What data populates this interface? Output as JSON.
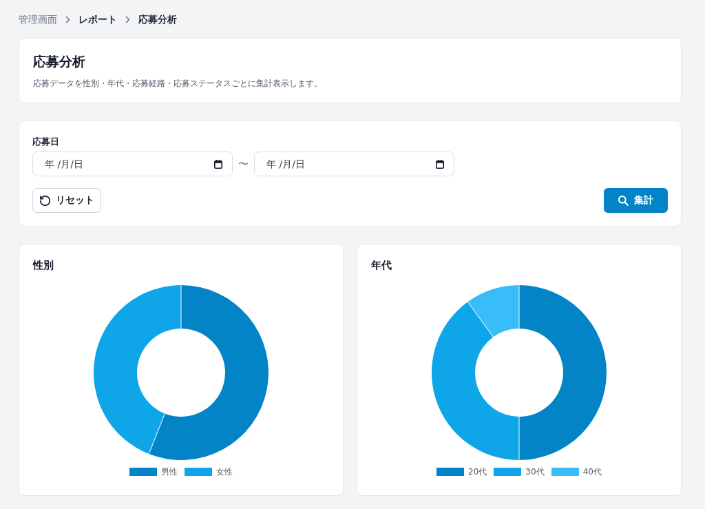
{
  "breadcrumb": [
    {
      "label": "管理画面",
      "kind": "link"
    },
    {
      "label": "レポート",
      "kind": "text"
    },
    {
      "label": "応募分析",
      "kind": "text"
    }
  ],
  "header": {
    "title": "応募分析",
    "description": "応募データを性別・年代・応募経路・応募ステータスごとに集計表示します。"
  },
  "filter": {
    "label": "応募日",
    "date_from": {
      "placeholder": "年 /月/日"
    },
    "separator": "〜",
    "date_to": {
      "placeholder": "年 /月/日"
    },
    "buttons": [
      {
        "label": "リセット",
        "kind": "reset"
      },
      {
        "label": "集計",
        "kind": "submit"
      }
    ]
  },
  "charts": [
    {
      "title": "性別",
      "chart_data": {
        "type": "donut",
        "categories": [
          "男性",
          "女性"
        ],
        "values": [
          56,
          44
        ],
        "colors": [
          "#0284c7",
          "#0ea5e9"
        ]
      }
    },
    {
      "title": "年代",
      "chart_data": {
        "type": "donut",
        "categories": [
          "20代",
          "30代",
          "40代"
        ],
        "values": [
          50,
          40,
          10
        ],
        "colors": [
          "#0284c7",
          "#0ea5e9",
          "#38bdf8"
        ]
      }
    }
  ]
}
